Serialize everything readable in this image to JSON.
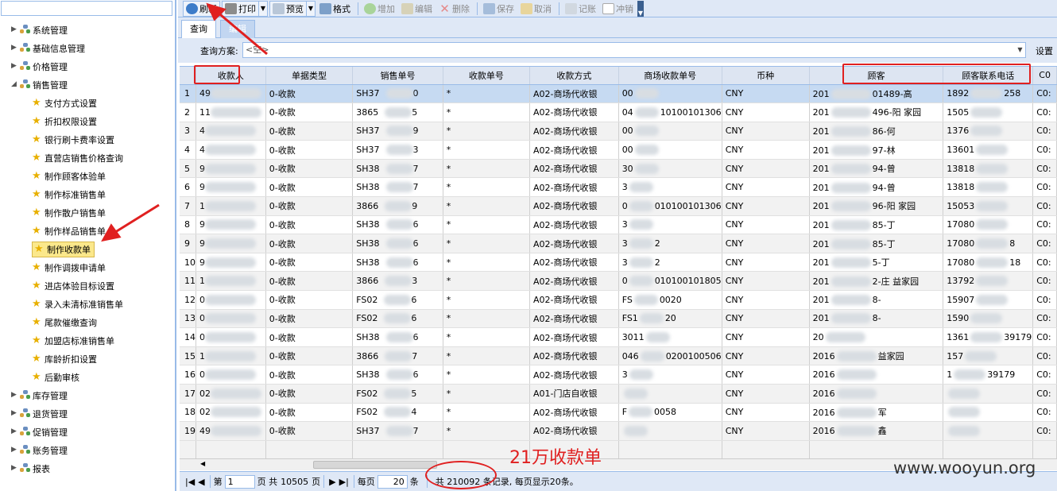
{
  "sidebar": {
    "groups_top": [
      {
        "label": "系统管理"
      },
      {
        "label": "基础信息管理"
      },
      {
        "label": "价格管理"
      }
    ],
    "sales_group": {
      "label": "销售管理"
    },
    "sales_items": [
      {
        "label": "支付方式设置"
      },
      {
        "label": "折扣权限设置"
      },
      {
        "label": "银行刷卡费率设置"
      },
      {
        "label": "直营店销售价格查询"
      },
      {
        "label": "制作顾客体验单"
      },
      {
        "label": "制作标准销售单"
      },
      {
        "label": "制作散户销售单"
      },
      {
        "label": "制作样品销售单"
      },
      {
        "label": "制作收款单"
      },
      {
        "label": "制作调拨申请单"
      },
      {
        "label": "进店体验目标设置"
      },
      {
        "label": "录入未清标准销售单"
      },
      {
        "label": "尾款催缴查询"
      },
      {
        "label": "加盟店标准销售单"
      },
      {
        "label": "库龄折扣设置"
      },
      {
        "label": "后勤审核"
      }
    ],
    "groups_bottom": [
      {
        "label": "库存管理"
      },
      {
        "label": "退货管理"
      },
      {
        "label": "促销管理"
      },
      {
        "label": "账务管理"
      },
      {
        "label": "报表"
      }
    ]
  },
  "toolbar": {
    "refresh": "刷新",
    "print": "打印",
    "preview": "预览",
    "format": "格式",
    "add": "增加",
    "edit": "编辑",
    "delete": "删除",
    "save": "保存",
    "cancel": "取消",
    "post": "记账",
    "reverse": "冲销"
  },
  "tabs": {
    "query": "查询",
    "edit": "编辑"
  },
  "query": {
    "label": "查询方案:",
    "value": "<空>",
    "settings": "设置"
  },
  "grid": {
    "columns": [
      "收款人",
      "单据类型",
      "销售单号",
      "收款单号",
      "收款方式",
      "商场收款单号",
      "币种",
      "顾客",
      "顾客联系电话",
      "C0"
    ],
    "rows": [
      [
        "1",
        "49",
        "0-收款",
        "SH37",
        "0",
        "*",
        "A02-商场代收银",
        "00",
        "",
        "CNY",
        "201",
        "01489-高",
        "1892",
        "258",
        "C0:"
      ],
      [
        "2",
        "11",
        "0-收款",
        "3865",
        "5",
        "*",
        "A02-商场代收银",
        "04",
        "10100101306",
        "CNY",
        "201",
        "496-阳 家园",
        "1505",
        "",
        "C0:"
      ],
      [
        "3",
        "4",
        "0-收款",
        "SH37",
        "9",
        "*",
        "A02-商场代收银",
        "00",
        "",
        "CNY",
        "201",
        "86-何",
        "1376",
        "",
        "C0:"
      ],
      [
        "4",
        "4",
        "0-收款",
        "SH37",
        "3",
        "*",
        "A02-商场代收银",
        "00",
        "",
        "CNY",
        "201",
        "97-林",
        "13601",
        "",
        "C0:"
      ],
      [
        "5",
        "9",
        "0-收款",
        "SH38",
        "7",
        "*",
        "A02-商场代收银",
        "30",
        "",
        "CNY",
        "201",
        "94-曾",
        "13818",
        "",
        "C0:"
      ],
      [
        "6",
        "9",
        "0-收款",
        "SH38",
        "7",
        "*",
        "A02-商场代收银",
        "3",
        "",
        "CNY",
        "201",
        "94-曾",
        "13818",
        "",
        "C0:"
      ],
      [
        "7",
        "1",
        "0-收款",
        "3866",
        "9",
        "*",
        "A02-商场代收银",
        "0",
        "010100101306",
        "CNY",
        "201",
        "96-阳 家园",
        "15053",
        "",
        "C0:"
      ],
      [
        "8",
        "9",
        "0-收款",
        "SH38",
        "6",
        "*",
        "A02-商场代收银",
        "3",
        "",
        "CNY",
        "201",
        "85-丁",
        "17080",
        "",
        "C0:"
      ],
      [
        "9",
        "9",
        "0-收款",
        "SH38",
        "6",
        "*",
        "A02-商场代收银",
        "3",
        "2",
        "CNY",
        "201",
        "85-丁",
        "17080",
        "8",
        "C0:"
      ],
      [
        "10",
        "9",
        "0-收款",
        "SH38",
        "6",
        "*",
        "A02-商场代收银",
        "3",
        "2",
        "CNY",
        "201",
        "5-丁",
        "17080",
        "18",
        "C0:"
      ],
      [
        "11",
        "1",
        "0-收款",
        "3866",
        "3",
        "*",
        "A02-商场代收银",
        "0",
        "010100101805",
        "CNY",
        "201",
        "2-庄 益家园",
        "13792",
        "",
        "C0:"
      ],
      [
        "12",
        "0",
        "0-收款",
        "FS02",
        "6",
        "*",
        "A02-商场代收银",
        "FS",
        "0020",
        "CNY",
        "201",
        "8-",
        "15907",
        "",
        "C0:"
      ],
      [
        "13",
        "0",
        "0-收款",
        "FS02",
        "6",
        "*",
        "A02-商场代收银",
        "FS1",
        "20",
        "CNY",
        "201",
        "8-",
        "1590",
        "",
        "C0:"
      ],
      [
        "14",
        "0",
        "0-收款",
        "SH38",
        "6",
        "*",
        "A02-商场代收银",
        "3011",
        "",
        "CNY",
        "20",
        "",
        "1361",
        "39179",
        "C0:"
      ],
      [
        "15",
        "1",
        "0-收款",
        "3866",
        "7",
        "*",
        "A02-商场代收银",
        "046",
        "0200100506",
        "CNY",
        "2016",
        "益家园",
        "157",
        "",
        "C0:"
      ],
      [
        "16",
        "0",
        "0-收款",
        "SH38",
        "6",
        "*",
        "A02-商场代收银",
        "3",
        "",
        "CNY",
        "2016",
        "",
        "1",
        "39179",
        "C0:"
      ],
      [
        "17",
        "02",
        "0-收款",
        "FS02",
        "5",
        "*",
        "A01-门店自收银",
        "",
        "",
        "CNY",
        "2016",
        "",
        "",
        "",
        "C0:"
      ],
      [
        "18",
        "02",
        "0-收款",
        "FS02",
        "4",
        "*",
        "A02-商场代收银",
        "F",
        "0058",
        "CNY",
        "2016",
        "军",
        "",
        "",
        "C0:"
      ],
      [
        "19",
        "49",
        "0-收款",
        "SH37",
        "7",
        "*",
        "A02-商场代收银",
        "",
        "",
        "CNY",
        "2016",
        "鑫",
        "",
        "",
        "C0:"
      ]
    ]
  },
  "pager": {
    "page_prefix": "第",
    "page_value": "1",
    "page_suffix": "页 共",
    "total_pages": "10505",
    "page_unit": "页",
    "per_page_label": "每页",
    "per_page_value": "20",
    "per_page_unit": "条",
    "total_text": "共 210092 条记录, 每页显示20条。"
  },
  "annotation": {
    "text": "21万收款单"
  },
  "watermark": "www.wooyun.org"
}
